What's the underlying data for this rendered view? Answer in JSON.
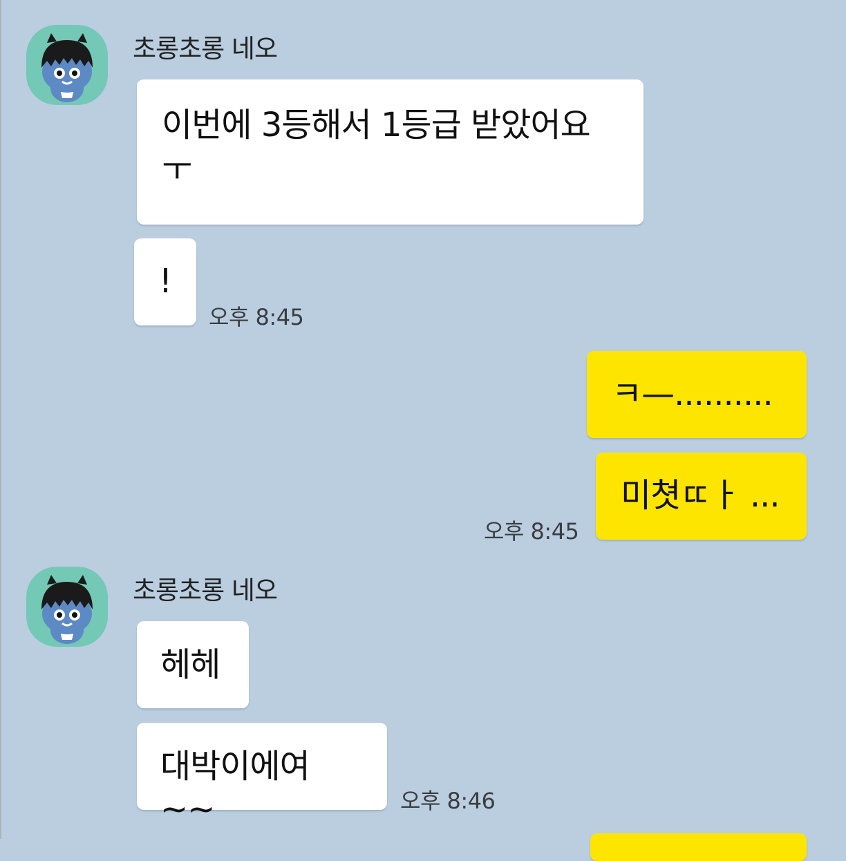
{
  "chat": {
    "group1": {
      "sender": "초롱초롱 네오",
      "messages": [
        "이번에 3등해서 1등급 받았어요",
        "ㅜ",
        "!"
      ],
      "time": "오후 8:45"
    },
    "mine1": {
      "messages": [
        "ㅋ—..........",
        "미쳣ㄸㅏ ..."
      ],
      "time": "오후 8:45"
    },
    "group2": {
      "sender": "초롱초롱 네오",
      "messages": [
        "헤헤",
        "대박이에여~~"
      ],
      "time": "오후 8:46"
    }
  },
  "colors": {
    "background": "#bacee0",
    "my_bubble": "#fee500",
    "other_bubble": "#ffffff",
    "avatar_bg": "#74c8b6"
  },
  "icons": {
    "avatar": "neo-character-avatar"
  }
}
